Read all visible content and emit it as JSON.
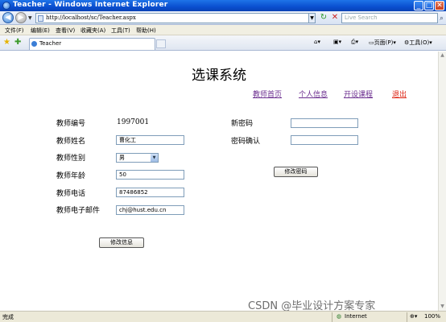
{
  "window": {
    "title": "Teacher - Windows Internet Explorer",
    "min_glyph": "_",
    "max_glyph": "□",
    "close_glyph": "✕"
  },
  "address": {
    "url": "http://localhost/sc/Teacher.aspx",
    "search_placeholder": "Live Search"
  },
  "menu": [
    "文件(F)",
    "编辑(E)",
    "查看(V)",
    "收藏夹(A)",
    "工具(T)",
    "帮助(H)"
  ],
  "tab": {
    "label": "Teacher"
  },
  "commands": {
    "page": "页面(P)",
    "tools": "工具(O)"
  },
  "page": {
    "heading": "选课系统",
    "nav": [
      "教师首页",
      "个人信息",
      "开设课程",
      "退出"
    ],
    "form": {
      "id_label": "教师编号",
      "id_value": "1997001",
      "name_label": "教师姓名",
      "name_value": "曹化工",
      "gender_label": "教师性别",
      "gender_value": "男",
      "age_label": "教师年龄",
      "age_value": "50",
      "phone_label": "教师电话",
      "phone_value": "87486852",
      "email_label": "教师电子邮件",
      "email_value": "chj@hust.edu.cn",
      "new_pwd_label": "新密码",
      "new_pwd_value": "",
      "confirm_pwd_label": "密码确认",
      "confirm_pwd_value": "",
      "change_pwd_button": "修改密码",
      "update_info_button": "修改信息"
    }
  },
  "status": {
    "left": "完成",
    "zone": "Internet",
    "zoom": "100%"
  },
  "watermark": "CSDN @毕业设计方案专家"
}
